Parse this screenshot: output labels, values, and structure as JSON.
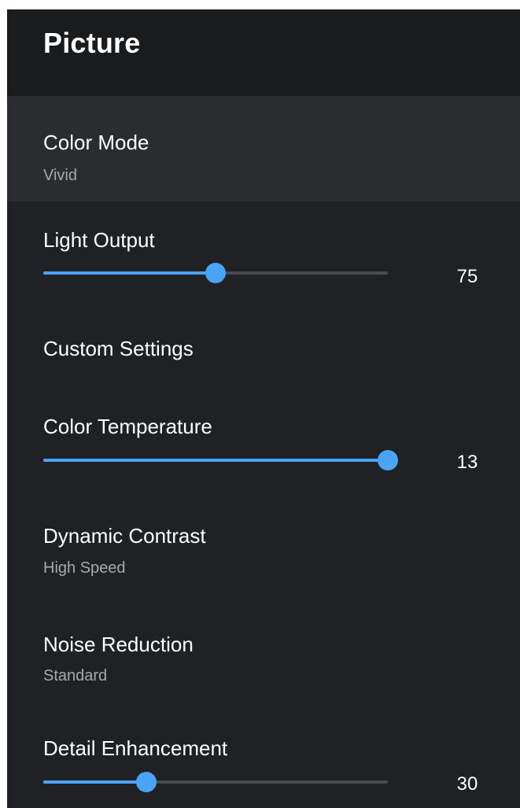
{
  "header": {
    "title": "Picture"
  },
  "menu": {
    "color_mode": {
      "label": "Color Mode",
      "value": "Vivid"
    },
    "light_output": {
      "label": "Light Output",
      "value": "75",
      "level": 0.5
    },
    "custom_settings": {
      "label": "Custom Settings"
    },
    "color_temperature": {
      "label": "Color Temperature",
      "value": "13",
      "level": 1.0
    },
    "dynamic_contrast": {
      "label": "Dynamic Contrast",
      "value": "High Speed"
    },
    "noise_reduction": {
      "label": "Noise Reduction",
      "value": "Standard"
    },
    "detail_enhancement": {
      "label": "Detail Enhancement",
      "value": "30",
      "level": 0.3
    }
  },
  "colors": {
    "accent": "#4aa3f5",
    "background": "#202124",
    "header_background": "#1a1b1d",
    "selected_background": "#2b2c2f",
    "track": "#4a4b4e"
  }
}
